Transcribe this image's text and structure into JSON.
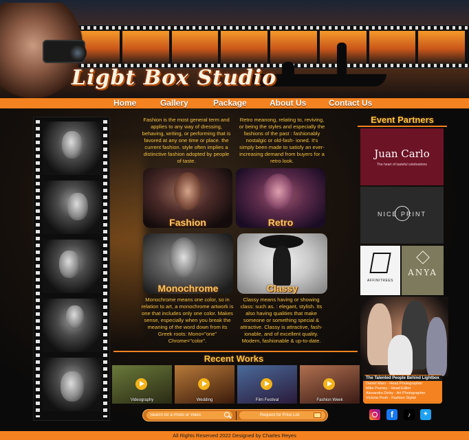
{
  "site": {
    "logo_text": "Ligbt Box Studio"
  },
  "nav": [
    "Home",
    "Gallery",
    "Package",
    "About Us",
    "Contact Us"
  ],
  "sections": {
    "fashion": {
      "text": "Fashion is the most general term and applies to any way of dressing, behaving, writing, or performing that is favored at any one time or place. the current fashion. style often implies a distinctive fashion adopted by people of taste.",
      "caption": "Fashion"
    },
    "retro": {
      "text": "Retro meanong, relating to, reviving, or being the styles and especially the fashions of the past : fashionably nostalgic or old-fash- ioned. It's simply been made to satisfy an ever-increasing demand from buyers for a retro look.",
      "caption": "Retro"
    },
    "monochrome": {
      "text": "Monochrome means one color, so in relation to art, a monochrome artwork is one that includes only one color. Makes sense, especially when you break the meaning of the word down from its Greek roots: Mono=\"one\" Chrome=\"color\".",
      "caption": "Monochrome"
    },
    "classy": {
      "text": "Classy means having or showing class: such as. : elegant, stylish. Its also having qualities that make someone or something special & attractive. Classy is attractive, fash- ionable, and of excellent quality. Modern, fashionable & up-to-date.",
      "caption": "Classy"
    }
  },
  "recent_works": {
    "title": "Recent Works",
    "items": [
      "Videography",
      "Wedding",
      "Film Festival",
      "Fashion Week"
    ]
  },
  "search": {
    "placeholder": "Search for a Photo or Video",
    "price_button": "Request for Price List"
  },
  "partners": {
    "title": "Event Partners",
    "juan_carlo": {
      "name": "Juan Carlo",
      "tagline": "The heart of tasteful celebrations"
    },
    "nice_print": {
      "name": "NICE PRINT",
      "monogram": "NP"
    },
    "affinitrees": {
      "name": "AFFINITREES"
    },
    "anya": {
      "name": "ANYA"
    }
  },
  "team": {
    "heading": "The Talented People Behind Lightbox",
    "members": [
      "Daniel Marz - Head Photographer",
      "Mike Posney - Head Editor",
      "Alexandra Delsy - Art Photographer",
      "Victoria Posh - Fashion Stylist"
    ]
  },
  "social": [
    "instagram-icon",
    "facebook-icon",
    "tiktok-icon",
    "twitter-icon"
  ],
  "footer": {
    "text": "All Rights Reserved 2022 Designed by Charles Reyes"
  },
  "colors": {
    "accent": "#f58220",
    "text_gold": "#f6c342",
    "background": "#0b0b0b"
  }
}
